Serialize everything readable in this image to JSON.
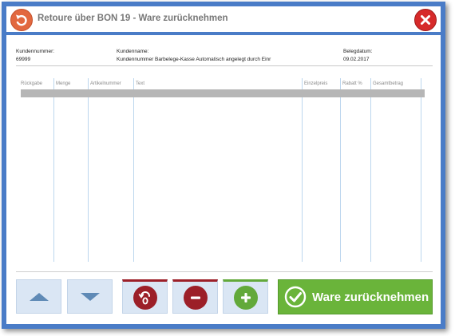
{
  "window": {
    "title": "Retoure über BON 19 - Ware zurücknehmen"
  },
  "header": {
    "customer_number_label": "Kundennummer:",
    "customer_number": "69999",
    "customer_name_label": "Kundenname:",
    "customer_name": "Kundennummer Barbelege-Kasse Automatisch angelegt durch Einr",
    "doc_date_label": "Belegdatum:",
    "doc_date": "09.02.2017"
  },
  "table": {
    "columns": [
      "Rückgabe",
      "Menge",
      "Artikelnummer",
      "Text",
      "Einzelpreis",
      "Rabatt %",
      "Gesamtbetrag"
    ],
    "rows": []
  },
  "footer": {
    "confirm_label": "Ware zurücknehmen"
  },
  "colors": {
    "frame": "#4a7cc7",
    "back_icon": "#e2683f",
    "close_icon": "#d62a2a",
    "red_action": "#9c1f28",
    "green_action": "#62a93a",
    "confirm": "#6ab43a",
    "nav_arrow": "#5f8ab6"
  },
  "icons": {
    "back": "undo-arrow-icon",
    "close": "close-x-icon",
    "up": "triangle-up-icon",
    "down": "triangle-down-icon",
    "return_item": "return-zero-icon",
    "minus": "minus-icon",
    "plus": "plus-icon",
    "confirm": "checkmark-icon"
  }
}
